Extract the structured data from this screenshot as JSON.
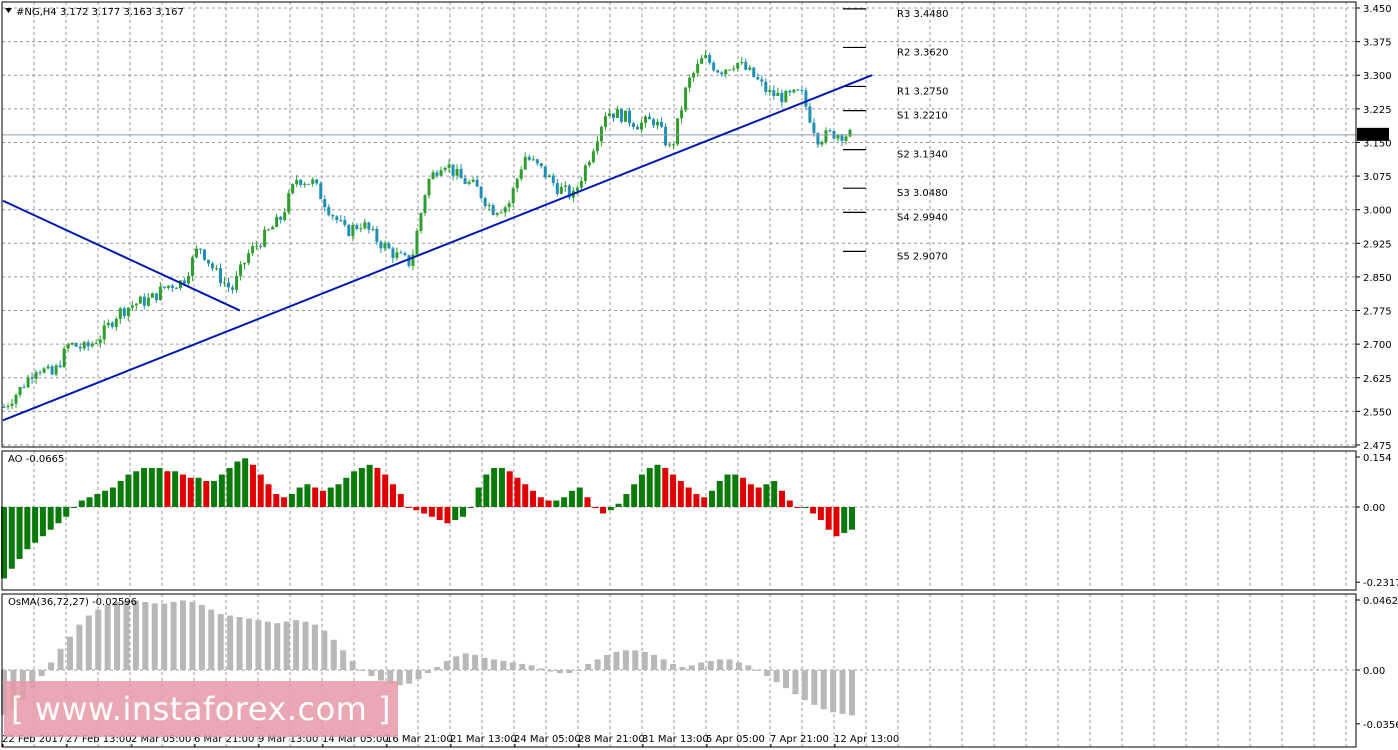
{
  "header": {
    "symbol_info": "#NG,H4  3.172 3.177 3.163 3.167",
    "ao_label": "AO -0.0665",
    "osma_label": "OsMA(36,72,27) -0.02596"
  },
  "watermark": "[ www.instaforex.com ]",
  "colors": {
    "bull": "#2e9e2e",
    "bear": "#1f8fb5",
    "trendline": "#0019b0",
    "ao_up": "#0a7a0a",
    "ao_down": "#e00000",
    "osma": "#b8b8b8",
    "grid": "#9a9a9a"
  },
  "chart_data": [
    {
      "type": "candlestick",
      "title": "#NG,H4",
      "ohlc_last": {
        "open": 3.172,
        "high": 3.177,
        "low": 3.163,
        "close": 3.167
      },
      "current_price": "3.167",
      "ylim": [
        2.475,
        3.45
      ],
      "y_ticks": [
        "3.450",
        "3.375",
        "3.300",
        "3.225",
        "3.150",
        "3.075",
        "3.000",
        "2.925",
        "2.850",
        "2.775",
        "2.700",
        "2.625",
        "2.550",
        "2.475"
      ],
      "x_ticks": [
        "22 Feb 2017",
        "27 Feb 13:00",
        "2 Mar 05:00",
        "6 Mar 21:00",
        "9 Mar 13:00",
        "14 Mar 05:00",
        "16 Mar 21:00",
        "21 Mar 13:00",
        "24 Mar 05:00",
        "28 Mar 21:00",
        "31 Mar 13:00",
        "5 Apr 05:00",
        "7 Apr 21:00",
        "12 Apr 13:00"
      ],
      "close_path": [
        2.56,
        2.6,
        2.65,
        2.63,
        2.7,
        2.69,
        2.72,
        2.77,
        2.79,
        2.8,
        2.83,
        2.84,
        2.92,
        2.86,
        2.82,
        2.9,
        2.94,
        2.98,
        3.07,
        3.06,
        3.0,
        2.95,
        2.97,
        2.93,
        2.9,
        2.88,
        3.06,
        3.11,
        3.07,
        3.05,
        3.0,
        3.01,
        3.12,
        3.09,
        3.05,
        3.03,
        3.12,
        3.22,
        3.21,
        3.19,
        3.2,
        3.13,
        3.28,
        3.34,
        3.31,
        3.33,
        3.3,
        3.26,
        3.25,
        3.26,
        3.16,
        3.17,
        3.167
      ],
      "levels": [
        {
          "name": "R3",
          "label": "R3 3.4480",
          "value": 3.448
        },
        {
          "name": "R2",
          "label": "R2 3.3620",
          "value": 3.362
        },
        {
          "name": "R1",
          "label": "R1 3.2750",
          "value": 3.275
        },
        {
          "name": "S1",
          "label": "S1 3.2210",
          "value": 3.221
        },
        {
          "name": "S2",
          "label": "S2 3.1340",
          "value": 3.134
        },
        {
          "name": "S3",
          "label": "S3 3.0480",
          "value": 3.048
        },
        {
          "name": "S4",
          "label": "S4 2.9940",
          "value": 2.994
        },
        {
          "name": "S5",
          "label": "S5 2.9070",
          "value": 2.907
        }
      ],
      "trendlines": [
        {
          "name": "rising-trendline",
          "from_price": 2.53,
          "to_price": 3.3
        },
        {
          "name": "falling-trendline",
          "from_price": 3.02,
          "to_price": 2.775
        }
      ]
    },
    {
      "type": "bar",
      "title": "AO",
      "last_value": -0.0665,
      "y_ticks": [
        "0.154",
        "0.00",
        "-0.2317"
      ],
      "ylim": [
        -0.2317,
        0.154
      ],
      "values": [
        -0.22,
        -0.19,
        -0.16,
        -0.13,
        -0.11,
        -0.09,
        -0.07,
        -0.05,
        -0.03,
        0.0,
        0.02,
        0.03,
        0.04,
        0.05,
        0.06,
        0.08,
        0.1,
        0.11,
        0.12,
        0.12,
        0.12,
        0.11,
        0.11,
        0.1,
        0.09,
        0.09,
        0.08,
        0.08,
        0.1,
        0.12,
        0.14,
        0.15,
        0.13,
        0.1,
        0.07,
        0.04,
        0.03,
        0.04,
        0.06,
        0.07,
        0.06,
        0.05,
        0.06,
        0.07,
        0.09,
        0.11,
        0.12,
        0.13,
        0.12,
        0.1,
        0.07,
        0.04,
        0.0,
        -0.01,
        -0.02,
        -0.03,
        -0.04,
        -0.05,
        -0.04,
        -0.03,
        0.0,
        0.06,
        0.1,
        0.12,
        0.12,
        0.11,
        0.09,
        0.07,
        0.05,
        0.03,
        0.02,
        0.02,
        0.03,
        0.05,
        0.06,
        0.03,
        0.0,
        -0.02,
        -0.01,
        0.01,
        0.04,
        0.07,
        0.1,
        0.12,
        0.13,
        0.12,
        0.1,
        0.08,
        0.06,
        0.04,
        0.03,
        0.05,
        0.08,
        0.1,
        0.1,
        0.09,
        0.07,
        0.06,
        0.07,
        0.08,
        0.05,
        0.02,
        0.0,
        0.0,
        -0.02,
        -0.04,
        -0.07,
        -0.09,
        -0.08,
        -0.07
      ]
    },
    {
      "type": "bar",
      "title": "OsMA(36,72,27)",
      "last_value": -0.02596,
      "y_ticks": [
        "0.04629",
        "0.00",
        "-0.0356"
      ],
      "ylim": [
        -0.0356,
        0.04629
      ],
      "values": [
        -0.03,
        -0.026,
        -0.02,
        -0.012,
        -0.004,
        0.005,
        0.014,
        0.022,
        0.03,
        0.036,
        0.04,
        0.043,
        0.045,
        0.046,
        0.046,
        0.045,
        0.044,
        0.044,
        0.045,
        0.046,
        0.045,
        0.043,
        0.04,
        0.037,
        0.036,
        0.035,
        0.034,
        0.033,
        0.032,
        0.031,
        0.032,
        0.033,
        0.032,
        0.03,
        0.026,
        0.02,
        0.013,
        0.006,
        0.0,
        -0.004,
        -0.007,
        -0.009,
        -0.01,
        -0.009,
        -0.006,
        -0.002,
        0.002,
        0.006,
        0.009,
        0.011,
        0.01,
        0.008,
        0.007,
        0.006,
        0.005,
        0.004,
        0.003,
        0.001,
        -0.001,
        -0.002,
        -0.002,
        0.0,
        0.004,
        0.007,
        0.01,
        0.012,
        0.013,
        0.013,
        0.012,
        0.01,
        0.007,
        0.004,
        0.002,
        0.003,
        0.005,
        0.006,
        0.007,
        0.007,
        0.005,
        0.003,
        0.0,
        -0.004,
        -0.008,
        -0.012,
        -0.016,
        -0.02,
        -0.023,
        -0.026,
        -0.028,
        -0.029,
        -0.03
      ]
    }
  ]
}
